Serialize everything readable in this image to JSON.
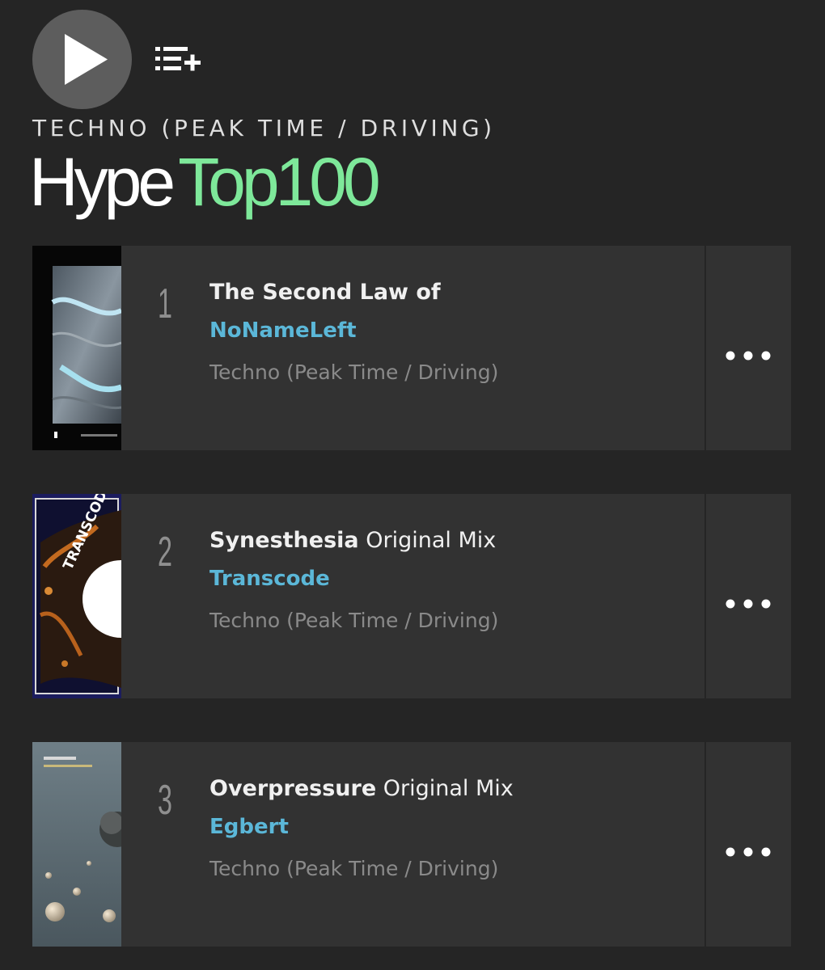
{
  "header": {
    "play_icon": "play-icon",
    "queue_icon": "add-to-queue-icon",
    "genre": "TECHNO (PEAK TIME / DRIVING)",
    "title_part1": "Hype",
    "title_part2": "Top100"
  },
  "colors": {
    "background": "#252525",
    "card": "#323232",
    "accent_green": "#7ee89a",
    "artist_blue": "#5bb7d8"
  },
  "tracks": [
    {
      "rank": "1",
      "title": "The Second Law of",
      "mix": "",
      "artist": "NoNameLeft",
      "genre": "Techno (Peak Time / Driving)",
      "more_icon": "more-options-icon"
    },
    {
      "rank": "2",
      "title": "Synesthesia",
      "mix": "Original Mix",
      "artist": "Transcode",
      "genre": "Techno (Peak Time / Driving)",
      "more_icon": "more-options-icon"
    },
    {
      "rank": "3",
      "title": "Overpressure",
      "mix": "Original Mix",
      "artist": "Egbert",
      "genre": "Techno (Peak Time / Driving)",
      "more_icon": "more-options-icon"
    }
  ]
}
